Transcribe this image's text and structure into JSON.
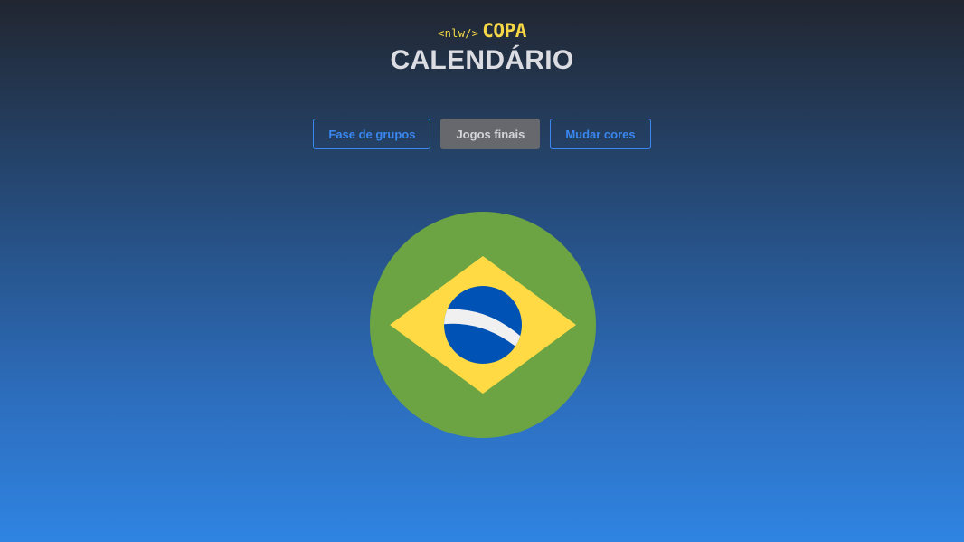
{
  "logo": {
    "code_text": "<nlw/>",
    "brand_text": "COPA"
  },
  "page": {
    "title": "CALENDÁRIO"
  },
  "nav": {
    "buttons": [
      {
        "label": "Fase de grupos",
        "active": false
      },
      {
        "label": "Jogos finais",
        "active": true
      },
      {
        "label": "Mudar cores",
        "active": false
      }
    ]
  },
  "flag": {
    "icon": "brazil-flag-icon",
    "colors": {
      "green": "#6ca443",
      "yellow": "#ffda44",
      "blue": "#0052b4",
      "white": "#f0f0f0"
    }
  },
  "colors": {
    "accent": "#3a87f0",
    "logo": "#f6d846",
    "title": "#dcdde3",
    "active_button_bg": "#66686e"
  }
}
